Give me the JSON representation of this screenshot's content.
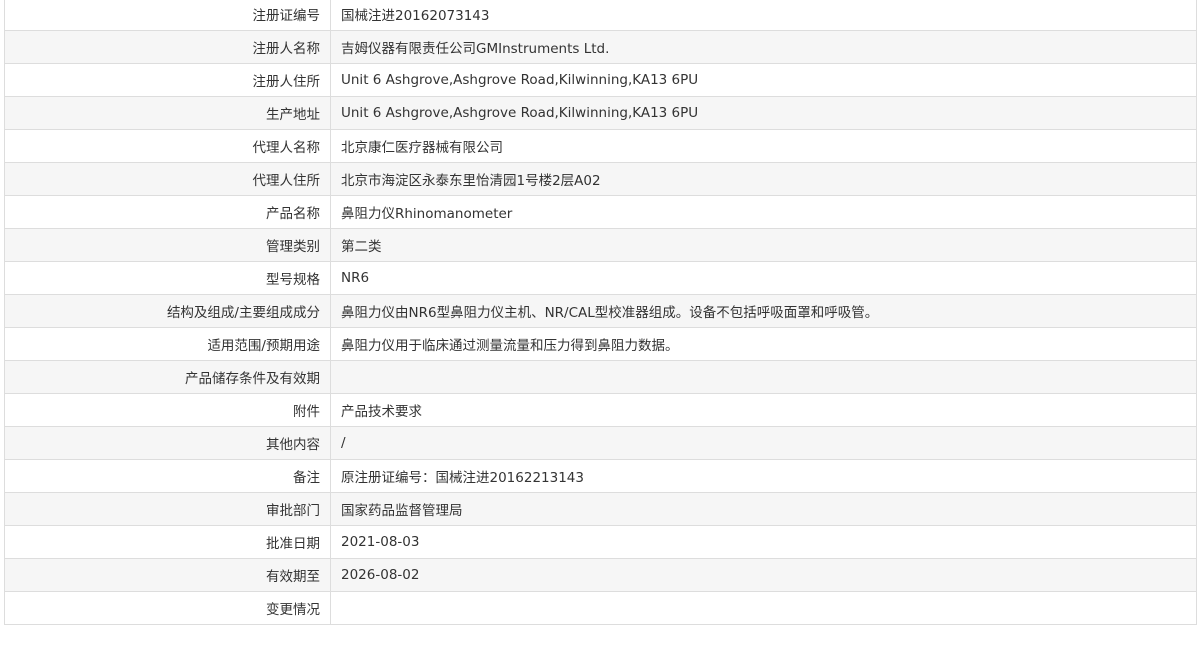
{
  "rows": [
    {
      "label": "注册证编号",
      "value": "国械注进20162073143"
    },
    {
      "label": "注册人名称",
      "value": "吉姆仪器有限责任公司GMInstruments Ltd."
    },
    {
      "label": "注册人住所",
      "value": "Unit 6 Ashgrove,Ashgrove Road,Kilwinning,KA13 6PU"
    },
    {
      "label": "生产地址",
      "value": "Unit 6 Ashgrove,Ashgrove Road,Kilwinning,KA13 6PU"
    },
    {
      "label": "代理人名称",
      "value": "北京康仁医疗器械有限公司"
    },
    {
      "label": "代理人住所",
      "value": "北京市海淀区永泰东里怡清园1号楼2层A02"
    },
    {
      "label": "产品名称",
      "value": "鼻阻力仪Rhinomanometer"
    },
    {
      "label": "管理类别",
      "value": "第二类"
    },
    {
      "label": "型号规格",
      "value": "NR6"
    },
    {
      "label": "结构及组成/主要组成成分",
      "value": "鼻阻力仪由NR6型鼻阻力仪主机、NR/CAL型校准器组成。设备不包括呼吸面罩和呼吸管。"
    },
    {
      "label": "适用范围/预期用途",
      "value": "鼻阻力仪用于临床通过测量流量和压力得到鼻阻力数据。"
    },
    {
      "label": "产品储存条件及有效期",
      "value": ""
    },
    {
      "label": "附件",
      "value": "产品技术要求"
    },
    {
      "label": "其他内容",
      "value": "/"
    },
    {
      "label": "备注",
      "value": "原注册证编号：国械注进20162213143"
    },
    {
      "label": "审批部门",
      "value": "国家药品监督管理局"
    },
    {
      "label": "批准日期",
      "value": "2021-08-03"
    },
    {
      "label": "有效期至",
      "value": "2026-08-02"
    },
    {
      "label": "变更情况",
      "value": ""
    }
  ]
}
